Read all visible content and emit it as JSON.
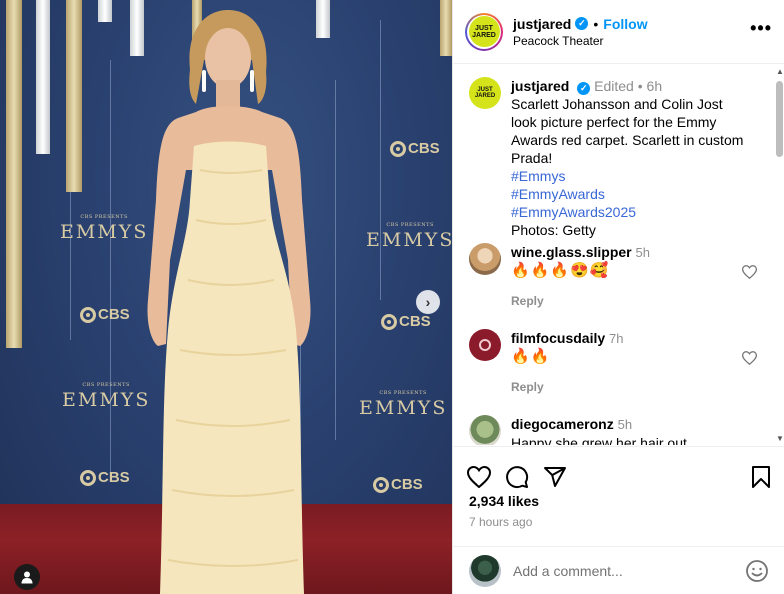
{
  "photo": {
    "wall_small_text": "CBS PRESENTS",
    "wall_big_text": "EMMYS",
    "wall_network": "CBS"
  },
  "header": {
    "username": "justjared",
    "separator": "•",
    "follow_label": "Follow",
    "location": "Peacock Theater",
    "avatar_text": "JUST JARED",
    "more_label": "•••"
  },
  "caption": {
    "username": "justjared",
    "edited": "Edited",
    "separator": "•",
    "time": "6h",
    "text": "Scarlett Johansson and Colin Jost look picture perfect for the Emmy Awards red carpet. Scarlett in custom Prada!",
    "hashtags": [
      "#Emmys",
      "#EmmyAwards",
      "#EmmyAwards2025"
    ],
    "credit": "Photos: Getty"
  },
  "comments": [
    {
      "username": "wine.glass.slipper",
      "time": "5h",
      "text": "🔥🔥🔥😍🥰",
      "reply_label": "Reply"
    },
    {
      "username": "filmfocusdaily",
      "time": "7h",
      "text": "🔥🔥",
      "reply_label": "Reply"
    },
    {
      "username": "diegocameronz",
      "time": "5h",
      "text": "Happy she grew her hair out"
    }
  ],
  "engagement": {
    "likes": "2,934 likes",
    "time_ago": "7 hours ago"
  },
  "add_comment": {
    "placeholder": "Add a comment..."
  },
  "colors": {
    "accent": "#0095f6",
    "hashtag": "#3867d6",
    "brand_yellow": "#d4e31a",
    "carpet": "#8c2127",
    "backdrop": "#2a4170"
  },
  "icons": [
    "like-icon",
    "comment-icon",
    "share-icon",
    "save-icon",
    "emoji-icon",
    "verified-icon",
    "more-icon",
    "chevron-right-icon",
    "user-tag-icon"
  ]
}
